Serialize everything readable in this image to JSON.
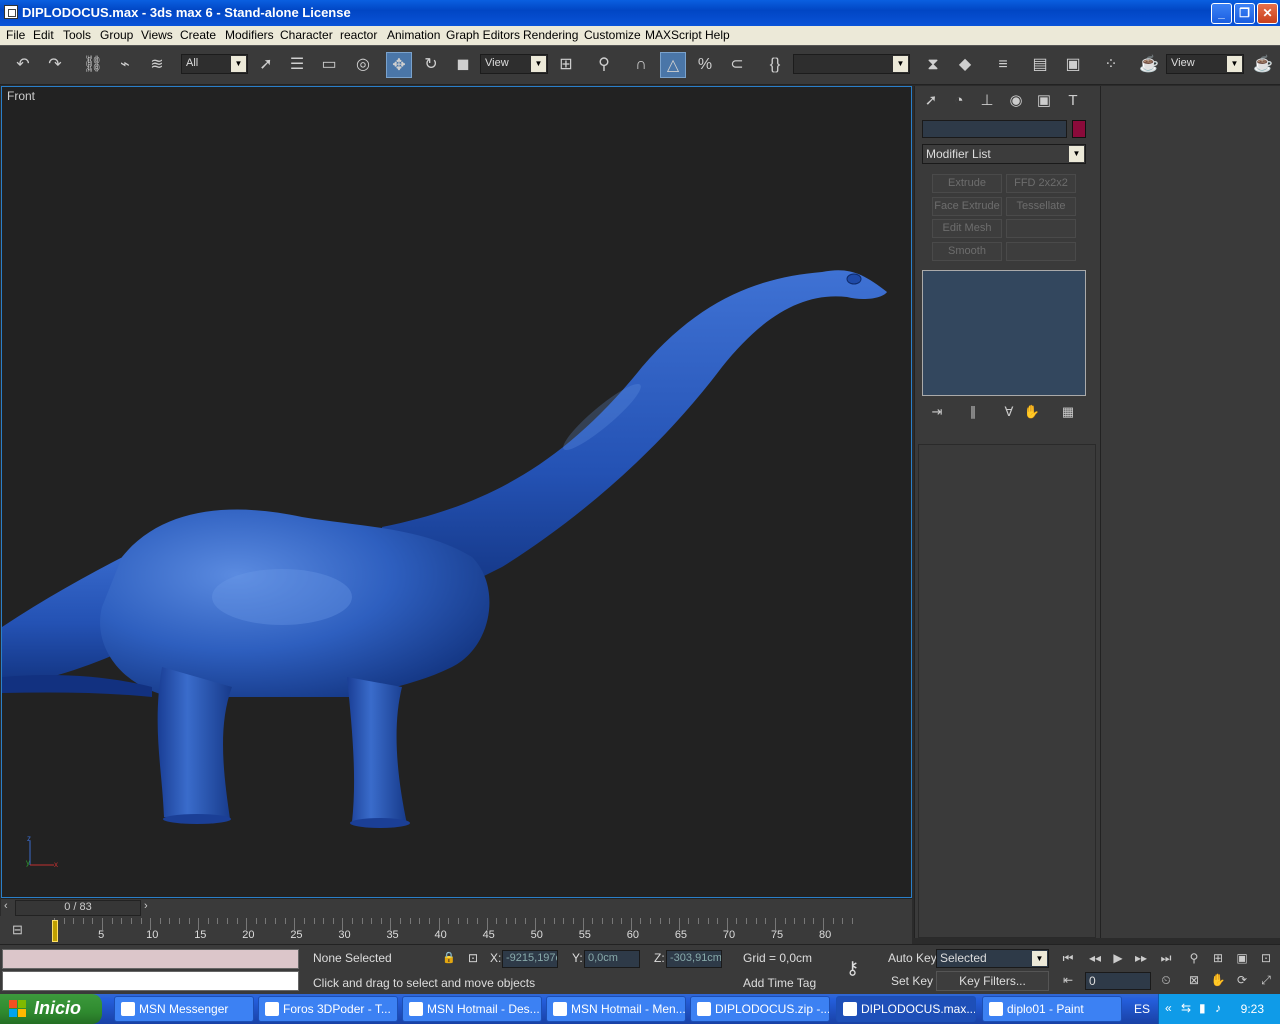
{
  "window": {
    "title": "DIPLODOCUS.max - 3ds max 6 - Stand-alone License",
    "minimize": "_",
    "restore": "❐",
    "close": "✕"
  },
  "menu": [
    "File",
    "Edit",
    "Tools",
    "Group",
    "Views",
    "Create",
    "Modifiers",
    "Character",
    "reactor",
    "Animation",
    "Graph Editors",
    "Rendering",
    "Customize",
    "MAXScript",
    "Help"
  ],
  "toolbar": {
    "selection_filter": "All",
    "ref_coord_1": "View",
    "ref_coord_2": "View",
    "named_selection": ""
  },
  "viewport": {
    "label": "Front",
    "axis_x": "x",
    "axis_z": "z",
    "axis_y": "y"
  },
  "command_panel": {
    "modifier_list": "Modifier List",
    "modifier_buttons": [
      "Extrude",
      "FFD 2x2x2",
      "Face Extrude",
      "Tessellate",
      "Edit Mesh",
      "",
      "Smooth",
      ""
    ],
    "object_color": "#8b0a3a"
  },
  "timeline": {
    "frame_display": "0 / 83",
    "ticks": [
      "0",
      "5",
      "10",
      "15",
      "20",
      "25",
      "30",
      "35",
      "40",
      "45",
      "50",
      "55",
      "60",
      "65",
      "70",
      "75",
      "80"
    ]
  },
  "status": {
    "selection": "None Selected",
    "prompt": "Click and drag to select and move objects",
    "x_label": "X:",
    "x_value": "-9215,197c",
    "y_label": "Y:",
    "y_value": "0,0cm",
    "z_label": "Z:",
    "z_value": "-303,91cm",
    "grid": "Grid = 0,0cm",
    "add_time_tag": "Add Time Tag",
    "auto_key": "Auto Key",
    "set_key": "Set Key",
    "key_mode": "Selected",
    "key_filters": "Key Filters...",
    "current_frame": "0"
  },
  "taskbar": {
    "start": "Inicio",
    "tasks": [
      "MSN Messenger",
      "Foros 3DPoder - T...",
      "MSN Hotmail - Des...",
      "MSN Hotmail - Men...",
      "DIPLODOCUS.zip -...",
      "DIPLODOCUS.max...",
      "diplo01 - Paint"
    ],
    "language": "ES",
    "clock": "9:23"
  }
}
